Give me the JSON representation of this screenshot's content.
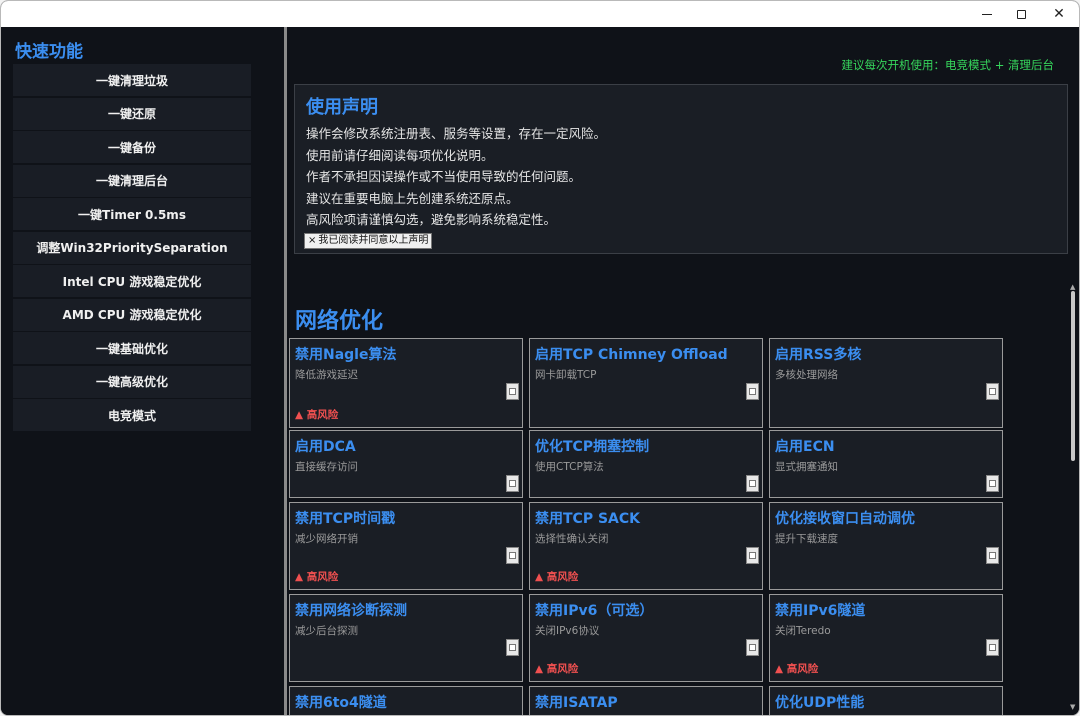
{
  "window": {
    "minimize_glyph": "",
    "maximize_glyph": "",
    "close_glyph": "✕"
  },
  "sidebar": {
    "title": "快速功能",
    "items": [
      {
        "label": "一键清理垃圾"
      },
      {
        "label": "一键还原"
      },
      {
        "label": "一键备份"
      },
      {
        "label": "一键清理后台"
      },
      {
        "label": "一键Timer 0.5ms"
      },
      {
        "label": "调整Win32PrioritySeparation"
      },
      {
        "label": "Intel CPU 游戏稳定优化"
      },
      {
        "label": "AMD CPU 游戏稳定优化"
      },
      {
        "label": "一键基础优化"
      },
      {
        "label": "一键高级优化"
      },
      {
        "label": "电竞模式"
      }
    ]
  },
  "main": {
    "tip": "建议每次开机使用：电竞模式 + 清理后台",
    "notice": {
      "title": "使用声明",
      "lines": [
        "操作会修改系统注册表、服务等设置，存在一定风险。",
        "使用前请仔细阅读每项优化说明。",
        "作者不承担因误操作或不当使用导致的任何问题。",
        "建议在重要电脑上先创建系统还原点。",
        "高风险项请谨慎勾选，避免影响系统稳定性。"
      ],
      "agree_mark": "×",
      "agree_label": "我已阅读并同意以上声明"
    },
    "section_title": "网络优化",
    "cards": [
      {
        "title": "禁用Nagle算法",
        "desc": "降低游戏延迟",
        "risk": "▲ 高风险"
      },
      {
        "title": "启用TCP Chimney Offload",
        "desc": "网卡卸载TCP",
        "risk": ""
      },
      {
        "title": "启用RSS多核",
        "desc": "多核处理网络",
        "risk": ""
      },
      {
        "title": "启用DCA",
        "desc": "直接缓存访问",
        "risk": ""
      },
      {
        "title": "优化TCP拥塞控制",
        "desc": "使用CTCP算法",
        "risk": ""
      },
      {
        "title": "启用ECN",
        "desc": "显式拥塞通知",
        "risk": ""
      },
      {
        "title": "禁用TCP时间戳",
        "desc": "减少网络开销",
        "risk": "▲ 高风险"
      },
      {
        "title": "禁用TCP SACK",
        "desc": "选择性确认关闭",
        "risk": "▲ 高风险"
      },
      {
        "title": "优化接收窗口自动调优",
        "desc": "提升下载速度",
        "risk": ""
      },
      {
        "title": "禁用网络诊断探测",
        "desc": "减少后台探测",
        "risk": ""
      },
      {
        "title": "禁用IPv6（可选）",
        "desc": "关闭IPv6协议",
        "risk": "▲ 高风险"
      },
      {
        "title": "禁用IPv6隧道",
        "desc": "关闭Teredo",
        "risk": "▲ 高风险"
      },
      {
        "title": "禁用6to4隧道",
        "desc": "",
        "risk": ""
      },
      {
        "title": "禁用ISATAP",
        "desc": "",
        "risk": ""
      },
      {
        "title": "优化UDP性能",
        "desc": "",
        "risk": ""
      }
    ]
  },
  "colors": {
    "accent": "#3b8ef0",
    "background": "#0f1218",
    "panel": "#1a1e25",
    "tip_green": "#36d65c",
    "risk_red": "#f05050"
  }
}
